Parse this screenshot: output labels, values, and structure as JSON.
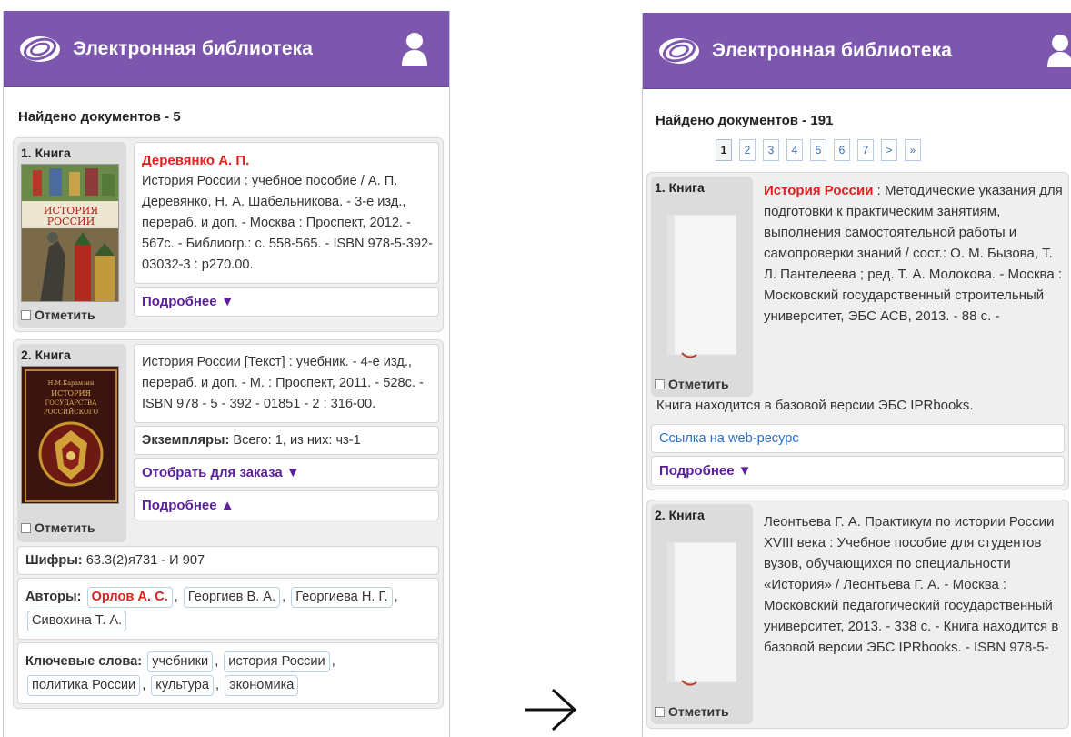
{
  "app": {
    "title": "Электронная библиотека",
    "brand_color": "#7d56ad"
  },
  "left": {
    "found": "Найдено документов - 5",
    "results": [
      {
        "label": "1. Книга",
        "author": "Деревянко А. П.",
        "text": "История России : учебное пособие / А. П. Деревянко, Н. А. Шабельникова. - 3-е изд., перераб. и доп. - Москва : Проспект, 2012. - 567с. - Библиогр.: с. 558-565. - ISBN 978-5-392-03032-3 : р270.00.",
        "mark": "Отметить",
        "more": "Подробнее ▼"
      },
      {
        "label": "2. Книга",
        "text": "История России [Текст] : учебник. - 4-е изд., перераб. и доп. - М. : Проспект, 2011. - 528с. - ISBN 978 - 5 - 392 - 01851 - 2 : 316-00.",
        "copies_label": "Экземпляры:",
        "copies_value": " Всего: 1, из них: чз-1",
        "order": "Отобрать для заказа ▼",
        "mark": "Отметить",
        "more": "Подробнее ▲",
        "codes_label": "Шифры:",
        "codes_value": " 63.3(2)я731 - И 907",
        "authors_label": "Авторы:",
        "authors": [
          "Орлов А. С.",
          "Георгиев В. А.",
          "Георгиева Н. Г.",
          "Сивохина Т. А."
        ],
        "keywords_label": "Ключевые слова:",
        "keywords": [
          "учебники",
          "история России",
          "политика России",
          "культура",
          "экономика"
        ]
      }
    ]
  },
  "right": {
    "found": "Найдено документов - 191",
    "pages": [
      "1",
      "2",
      "3",
      "4",
      "5",
      "6",
      "7",
      ">",
      "»"
    ],
    "results": [
      {
        "label": "1. Книга",
        "title_red": "История России",
        "text": " : Методические указания для подготовки к практическим занятиям, выполнения самостоятельной работы и самопроверки знаний / сост.: О. М. Бызова, Т. Л. Пантелеева ; ред. Т. А. Молокова. - Москва : Московский государственный строительный университет, ЭБС АСВ, 2013. - 88 с. -",
        "text_full": "Книга находится в базовой версии ЭБС IPRbooks.",
        "mark": "Отметить",
        "web": "Ссылка на web-ресурс",
        "more": "Подробнее ▼"
      },
      {
        "label": "2. Книга",
        "text": "Леонтьева Г. А. Практикум по истории России XVIII века : Учебное пособие для студентов вузов, обучающихся по специальности «История» / Леонтьева Г. А. - Москва : Московский педагогический государственный университет, 2013. - 338 с. - Книга находится в базовой версии ЭБС IPRbooks. - ISBN 978-5-",
        "mark": "Отметить"
      }
    ]
  },
  "cover1_text": [
    "ИСТОРИЯ",
    "РОССИИ"
  ],
  "cover2_text": [
    "Н.М.Карамзин",
    "ИСТОРИЯ",
    "ГОСУДАРСТВА",
    "РОССИЙСКОГО"
  ]
}
